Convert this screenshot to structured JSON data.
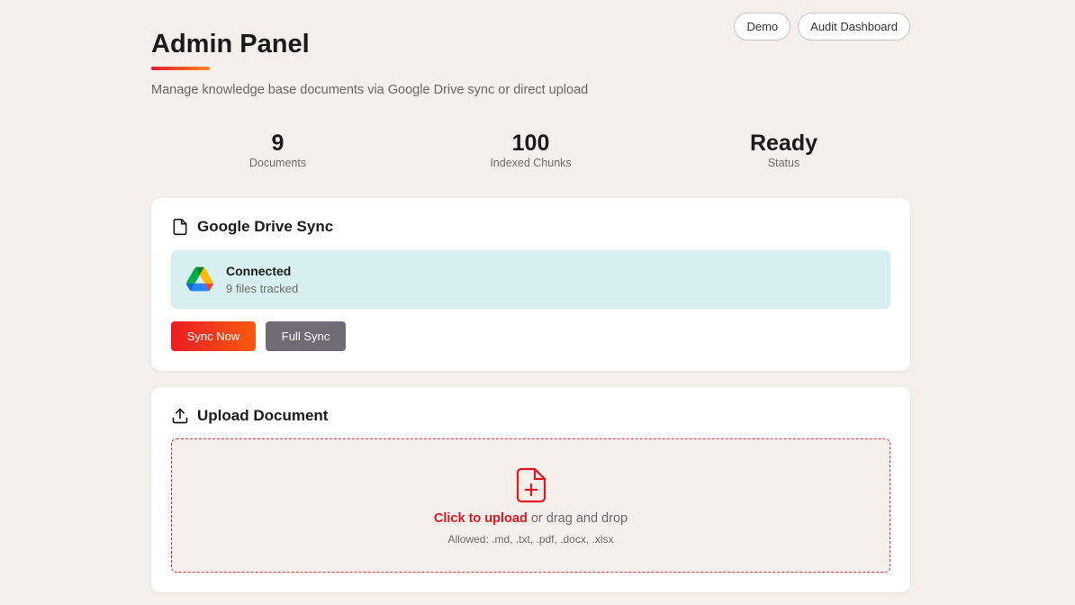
{
  "header": {
    "title": "Admin Panel",
    "subtitle": "Manage knowledge base documents via Google Drive sync or direct upload",
    "demo_button": "Demo",
    "audit_button": "Audit Dashboard",
    "accent_gradient": [
      "#e8192c",
      "#f7871e"
    ]
  },
  "stats": [
    {
      "value": "9",
      "label": "Documents"
    },
    {
      "value": "100",
      "label": "Indexed Chunks"
    },
    {
      "value": "Ready",
      "label": "Status"
    }
  ],
  "drive_sync": {
    "title": "Google Drive Sync",
    "icon": "file-icon",
    "status_title": "Connected",
    "status_sub": "9 files tracked",
    "status_bg": "#d8eff1",
    "sync_now_label": "Sync Now",
    "full_sync_label": "Full Sync"
  },
  "upload": {
    "title": "Upload Document",
    "icon": "upload-icon",
    "click_text": "Click to upload",
    "rest_text": " or drag and drop",
    "allowed": "Allowed: .md, .txt, .pdf, .docx, .xlsx"
  }
}
